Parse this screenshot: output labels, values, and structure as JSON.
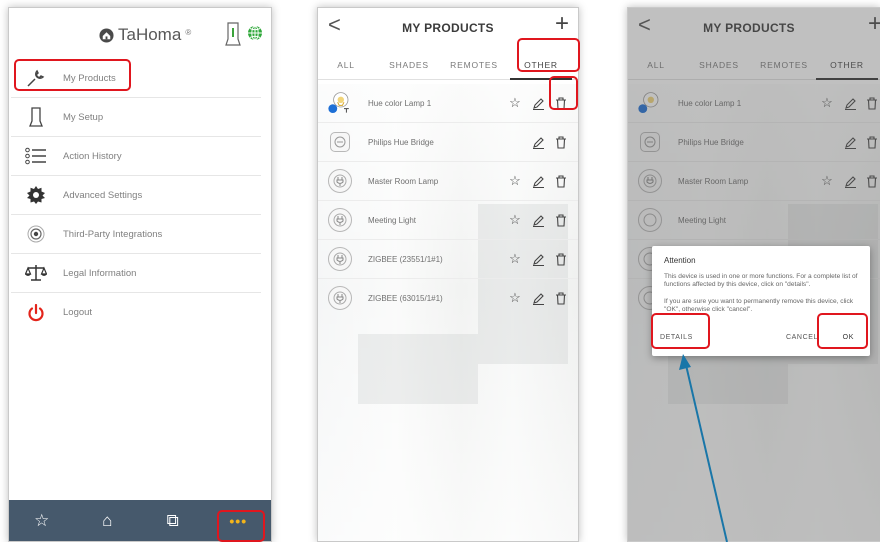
{
  "colors": {
    "highlight": "#e0161e",
    "navbar": "#46596c",
    "more_dots": "#f3b41a",
    "arrow": "#1976a8"
  },
  "panel1": {
    "logo_text": "TaHoma",
    "logo_mark": "®",
    "menu": [
      {
        "label": "My Products",
        "icon": "wrench-icon"
      },
      {
        "label": "My Setup",
        "icon": "gateway-icon"
      },
      {
        "label": "Action History",
        "icon": "list-icon"
      },
      {
        "label": "Advanced Settings",
        "icon": "gear-icon"
      },
      {
        "label": "Third-Party Integrations",
        "icon": "target-icon"
      },
      {
        "label": "Legal Information",
        "icon": "scales-icon"
      },
      {
        "label": "Logout",
        "icon": "power-icon"
      }
    ],
    "bottom_nav": [
      {
        "name": "favorites",
        "glyph": "☆"
      },
      {
        "name": "home",
        "glyph": "⌂"
      },
      {
        "name": "scenarios",
        "glyph": "⧉"
      },
      {
        "name": "more",
        "glyph": "•••"
      }
    ]
  },
  "products": {
    "back_glyph": "<",
    "title": "MY PRODUCTS",
    "add_glyph": "+",
    "tabs": [
      "ALL",
      "SHADES",
      "REMOTES",
      "OTHER"
    ],
    "items": [
      {
        "name": "Hue color Lamp 1",
        "icon": "bulb-icon",
        "favorite": true
      },
      {
        "name": "Philips Hue Bridge",
        "icon": "bridge-icon",
        "favorite": false
      },
      {
        "name": "Master Room Lamp",
        "icon": "plug-icon",
        "favorite": true
      },
      {
        "name": "Meeting Light",
        "icon": "plug-icon",
        "favorite": true
      },
      {
        "name": "ZIGBEE (23551/1#1)",
        "icon": "plug-icon",
        "favorite": true
      },
      {
        "name": "ZIGBEE (63015/1#1)",
        "icon": "plug-icon",
        "favorite": true
      }
    ]
  },
  "dialog": {
    "title": "Attention",
    "message": "This device is used in one or more functions. For a complete list of functions affected by this device, click on \"details\".\n\nIf you are sure you want to permanently remove this device, click \"OK\", otherwise click \"cancel\".",
    "details": "DETAILS",
    "cancel": "CANCEL",
    "ok": "OK"
  }
}
